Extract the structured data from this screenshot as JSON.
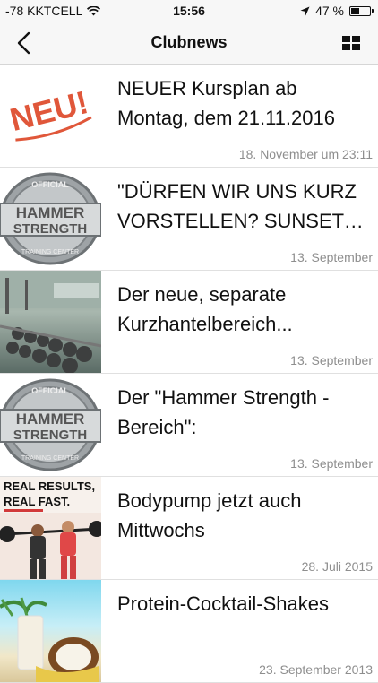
{
  "status": {
    "carrier": "-78 KKTCELL",
    "time": "15:56",
    "battery": "47 %",
    "battery_level": 0.47
  },
  "nav": {
    "title": "Clubnews"
  },
  "items": [
    {
      "title": "NEUER Kursplan ab Montag, dem 21.11.2016",
      "date": "18. November um 23:11",
      "thumb_text": "NEU!"
    },
    {
      "title": "\"DÜRFEN WIR UNS KURZ VORSTELLEN? SUNSET SPO…",
      "date": "13. September",
      "thumb_text": {
        "top": "OFFICIAL",
        "line1": "HAMMER",
        "line2": "STRENGTH",
        "bottom": "TRAINING CENTER"
      }
    },
    {
      "title": "Der neue, separate Kurzhantelbereich...",
      "date": "13. September"
    },
    {
      "title": "Der \"Hammer Strength - Bereich\":",
      "date": "13. September",
      "thumb_text": {
        "top": "OFFICIAL",
        "line1": "HAMMER",
        "line2": "STRENGTH",
        "bottom": "TRAINING CENTER"
      }
    },
    {
      "title": "Bodypump jetzt auch Mittwochs",
      "date": "28. Juli 2015",
      "thumb_text": {
        "line1": "REAL RESULTS,",
        "line2": "REAL FAST."
      }
    },
    {
      "title": "Protein-Cocktail-Shakes",
      "date": "23. September 2013"
    }
  ]
}
